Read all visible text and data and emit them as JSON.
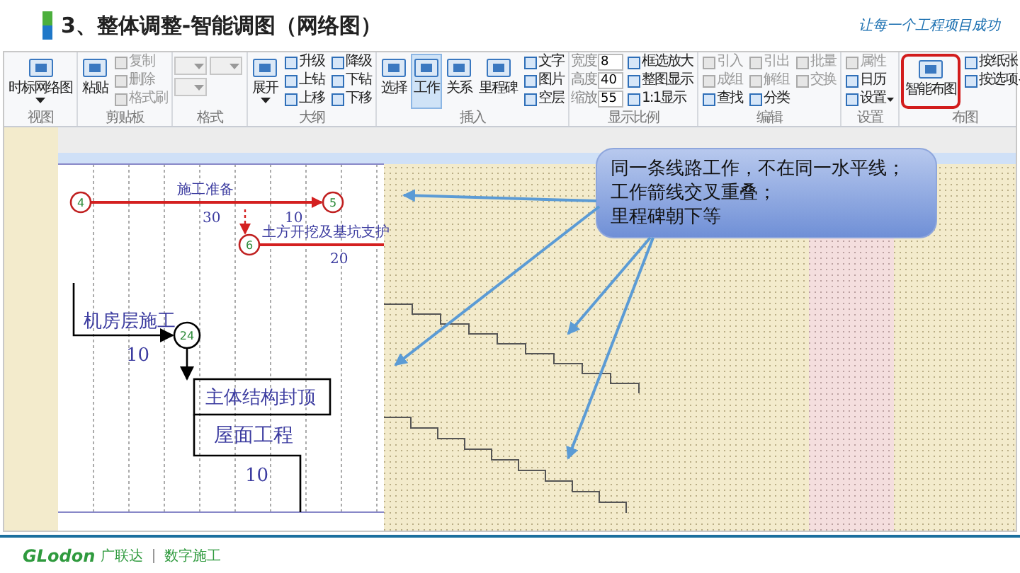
{
  "slide": {
    "title": "3、整体调整-智能调图（网络图）",
    "tagline": "让每一个工程项目成功"
  },
  "ribbon": {
    "groups": [
      {
        "label": "视图",
        "items": [
          {
            "kind": "large",
            "label": "时标网络图",
            "menu": true,
            "selected": false,
            "highlighted": false
          }
        ]
      },
      {
        "label": "剪贴板",
        "items": [
          {
            "kind": "large",
            "label": "粘贴",
            "menu": false,
            "selected": false,
            "highlighted": false
          },
          {
            "kind": "small",
            "label": "复制",
            "disabled": true,
            "menu": false
          },
          {
            "kind": "small",
            "label": "删除",
            "disabled": true,
            "menu": false
          },
          {
            "kind": "small",
            "label": "格式刷",
            "disabled": true,
            "menu": false
          }
        ]
      },
      {
        "label": "格式",
        "items": [
          {
            "kind": "dropdown"
          },
          {
            "kind": "dropdown"
          },
          {
            "kind": "dropdown"
          }
        ]
      },
      {
        "label": "大纲",
        "items": [
          {
            "kind": "large",
            "label": "展开",
            "menu": true,
            "selected": false,
            "highlighted": false
          },
          {
            "kind": "small",
            "label": "升级",
            "disabled": false,
            "menu": false
          },
          {
            "kind": "small",
            "label": "上钻",
            "disabled": false,
            "menu": false
          },
          {
            "kind": "small",
            "label": "上移",
            "disabled": false,
            "menu": false
          },
          {
            "kind": "small",
            "label": "降级",
            "disabled": false,
            "menu": false
          },
          {
            "kind": "small",
            "label": "下钻",
            "disabled": false,
            "menu": false
          },
          {
            "kind": "small",
            "label": "下移",
            "disabled": false,
            "menu": false
          }
        ]
      },
      {
        "label": "插入",
        "items": [
          {
            "kind": "large",
            "label": "选择",
            "menu": false,
            "selected": false,
            "highlighted": false
          },
          {
            "kind": "large",
            "label": "工作",
            "menu": false,
            "selected": true,
            "highlighted": false
          },
          {
            "kind": "large",
            "label": "关系",
            "menu": false,
            "selected": false,
            "highlighted": false
          },
          {
            "kind": "large",
            "label": "里程碑",
            "menu": false,
            "selected": false,
            "highlighted": false
          },
          {
            "kind": "small",
            "label": "文字",
            "disabled": false,
            "menu": false
          },
          {
            "kind": "small",
            "label": "图片",
            "disabled": false,
            "menu": false
          },
          {
            "kind": "small",
            "label": "空层",
            "disabled": false,
            "menu": false
          }
        ]
      },
      {
        "label": "显示比例",
        "items": [
          {
            "kind": "spinner",
            "label": "宽度",
            "value": "8"
          },
          {
            "kind": "spinner",
            "label": "高度",
            "value": "40"
          },
          {
            "kind": "spinner",
            "label": "缩放",
            "value": "55"
          },
          {
            "kind": "small",
            "label": "框选放大",
            "disabled": false,
            "menu": false
          },
          {
            "kind": "small",
            "label": "整图显示",
            "disabled": false,
            "menu": false
          },
          {
            "kind": "small",
            "label": "1:1显示",
            "disabled": false,
            "menu": false
          }
        ]
      },
      {
        "label": "编辑",
        "items": [
          {
            "kind": "small",
            "label": "引入",
            "disabled": true,
            "menu": false
          },
          {
            "kind": "small",
            "label": "成组",
            "disabled": true,
            "menu": false
          },
          {
            "kind": "small",
            "label": "查找",
            "disabled": false,
            "menu": false
          },
          {
            "kind": "small",
            "label": "引出",
            "disabled": true,
            "menu": false
          },
          {
            "kind": "small",
            "label": "解组",
            "disabled": true,
            "menu": false
          },
          {
            "kind": "small",
            "label": "分类",
            "disabled": false,
            "menu": false
          },
          {
            "kind": "small",
            "label": "批量",
            "disabled": true,
            "menu": false
          },
          {
            "kind": "small",
            "label": "交换",
            "disabled": true,
            "menu": false
          }
        ]
      },
      {
        "label": "设置",
        "items": [
          {
            "kind": "small",
            "label": "属性",
            "disabled": true,
            "menu": false
          },
          {
            "kind": "small",
            "label": "日历",
            "disabled": false,
            "menu": false
          },
          {
            "kind": "small",
            "label": "设置",
            "disabled": false,
            "menu": true
          }
        ]
      },
      {
        "label": "布图",
        "items": [
          {
            "kind": "large",
            "label": "智能布图",
            "menu": false,
            "selected": false,
            "highlighted": true
          },
          {
            "kind": "small",
            "label": "按纸张",
            "disabled": false,
            "menu": false
          },
          {
            "kind": "small",
            "label": "按选项",
            "disabled": false,
            "menu": true
          }
        ]
      }
    ]
  },
  "network": {
    "nodes": [
      {
        "label": "4",
        "critical": true
      },
      {
        "label": "5",
        "critical": true
      },
      {
        "label": "6",
        "critical": true
      },
      {
        "label": "24",
        "critical": false
      }
    ],
    "labels": [
      "施工准备",
      "30",
      "10",
      "土方开挖及基坑支护",
      "20",
      "机房层施工",
      "10",
      "主体结构封顶",
      "屋面工程",
      "10"
    ]
  },
  "callout": {
    "lines": [
      "同一条线路工作，不在同一水平线；",
      "工作箭线交叉重叠；",
      "里程碑朝下等"
    ]
  },
  "footer": {
    "logo": "GLodon",
    "brand": "广联达",
    "tagline": "数字施工"
  }
}
